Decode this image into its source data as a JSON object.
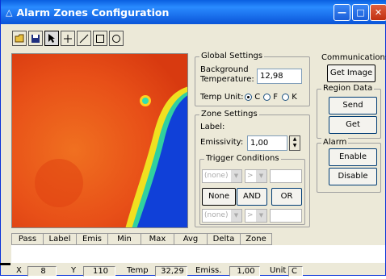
{
  "window": {
    "title": "Alarm Zones Configuration",
    "title_icon": "warning-triangle-icon"
  },
  "toolbar": {
    "tools": [
      "open-folder-icon",
      "save-icon",
      "pointer-icon",
      "crosshair-icon",
      "line-icon",
      "rectangle-icon",
      "ellipse-icon"
    ]
  },
  "global": {
    "title": "Global Settings",
    "bg_label_1": "Background",
    "bg_label_2": "Temperature:",
    "bg_value": "12,98",
    "temp_unit_label": "Temp Unit:",
    "units": [
      "C",
      "F",
      "K"
    ],
    "selected_unit": "C"
  },
  "zone": {
    "title": "Zone Settings",
    "label_text": "Label:",
    "emissivity_label": "Emissivity:",
    "emissivity_value": "1,00"
  },
  "trigger": {
    "title": "Trigger Conditions",
    "dd1": "(none)",
    "op1": ">",
    "none_btn": "None",
    "and_btn": "AND",
    "or_btn": "OR",
    "dd2": "(none)",
    "op2": ">"
  },
  "comms": {
    "title": "Communications",
    "get_image": "Get Image"
  },
  "region": {
    "title": "Region Data",
    "send": "Send",
    "get": "Get"
  },
  "alarm": {
    "title": "Alarm",
    "enable": "Enable",
    "disable": "Disable"
  },
  "columns": [
    "Pass",
    "Label",
    "Emis",
    "Min",
    "Max",
    "Avg",
    "Delta",
    "Zone"
  ],
  "status": {
    "x_label": "X",
    "x_value": "8",
    "y_label": "Y",
    "y_value": "110",
    "temp_label": "Temp",
    "temp_value": "32,29",
    "emiss_label": "Emiss.",
    "emiss_value": "1,00",
    "unit_label": "Unit",
    "unit_value": "C"
  },
  "colors": {
    "title_bar": "#0a5fe0",
    "thermal_hot": "#e8501a",
    "thermal_cold": "#1040d8"
  }
}
